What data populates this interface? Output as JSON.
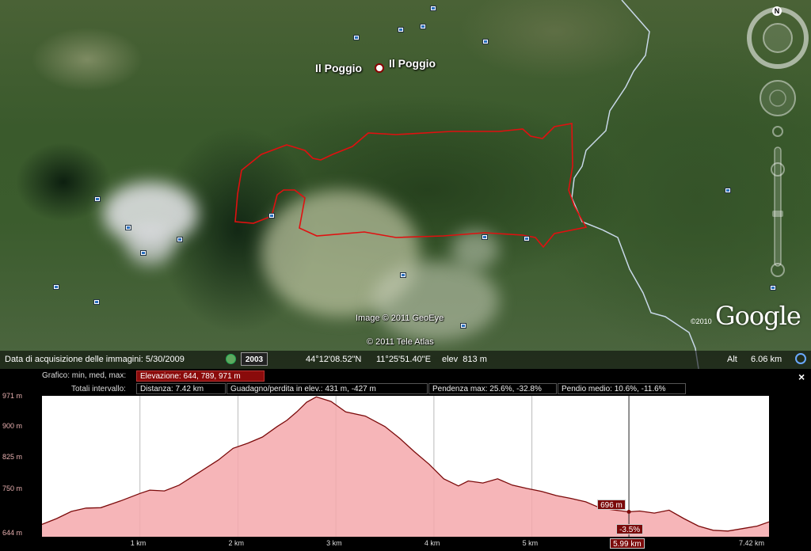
{
  "map": {
    "place_labels": [
      "Il Poggio",
      "Il Poggio"
    ],
    "imagery_credit": "Image © 2011 GeoEye",
    "tele_atlas_credit": "© 2011 Tele Atlas",
    "google_year": "©2010",
    "google_logo": "Google",
    "compass_letter": "N",
    "track_color": "#e01010",
    "border_color": "#c8d8e8"
  },
  "status_bar": {
    "acquisition_label": "Data di acquisizione delle immagini: 5/30/2009",
    "year_button": "2003",
    "latitude": "44°12'08.52\"N",
    "longitude": "11°25'51.40\"E",
    "elevation": "elev  813 m",
    "alt_label": "Alt",
    "alt_value": "6.06 km"
  },
  "profile": {
    "row1_label": "Grafico: min, med, max:",
    "elevation_box": "Elevazione: 644, 789, 971 m",
    "row2_label": "Totali intervallo:",
    "distance_box": "Distanza: 7.42 km",
    "gain_box": "Guadagno/perdita in elev.: 431 m, -427 m",
    "max_slope_box": "Pendenza max: 25.6%, -32.8%",
    "avg_slope_box": "Pendio medio: 10.6%, -11.6%",
    "close": "×",
    "cursor_elev": "696 m",
    "cursor_slope": "-3.5%",
    "cursor_dist": "5.99 km",
    "accent_color": "#7b0a0a",
    "fill_color": "#f4a8ac"
  },
  "chart_data": {
    "type": "area",
    "xlabel": "",
    "ylabel": "",
    "y_ticks": [
      "971 m",
      "900 m",
      "825 m",
      "750 m",
      "644 m"
    ],
    "x_ticks": [
      "1 km",
      "2 km",
      "3 km",
      "4 km",
      "5 km",
      "5.99 km",
      "7.42 km"
    ],
    "ylim": [
      644,
      971
    ],
    "xlim": [
      0,
      7.42
    ],
    "cursor_x": 5.99,
    "x": [
      0,
      0.15,
      0.3,
      0.45,
      0.6,
      0.8,
      1.0,
      1.1,
      1.25,
      1.4,
      1.6,
      1.8,
      1.95,
      2.1,
      2.25,
      2.4,
      2.5,
      2.6,
      2.7,
      2.8,
      2.95,
      3.1,
      3.3,
      3.5,
      3.65,
      3.8,
      3.95,
      4.1,
      4.25,
      4.35,
      4.5,
      4.65,
      4.8,
      4.95,
      5.1,
      5.25,
      5.4,
      5.55,
      5.7,
      5.85,
      5.99,
      6.1,
      6.25,
      6.4,
      6.55,
      6.7,
      6.85,
      7.0,
      7.15,
      7.3,
      7.42
    ],
    "values": [
      666,
      680,
      697,
      705,
      706,
      722,
      740,
      748,
      746,
      760,
      790,
      820,
      848,
      860,
      875,
      900,
      915,
      935,
      958,
      971,
      960,
      935,
      925,
      900,
      872,
      840,
      810,
      775,
      758,
      770,
      765,
      775,
      760,
      752,
      745,
      735,
      728,
      720,
      705,
      700,
      696,
      698,
      693,
      700,
      680,
      662,
      652,
      650,
      656,
      662,
      672
    ]
  }
}
